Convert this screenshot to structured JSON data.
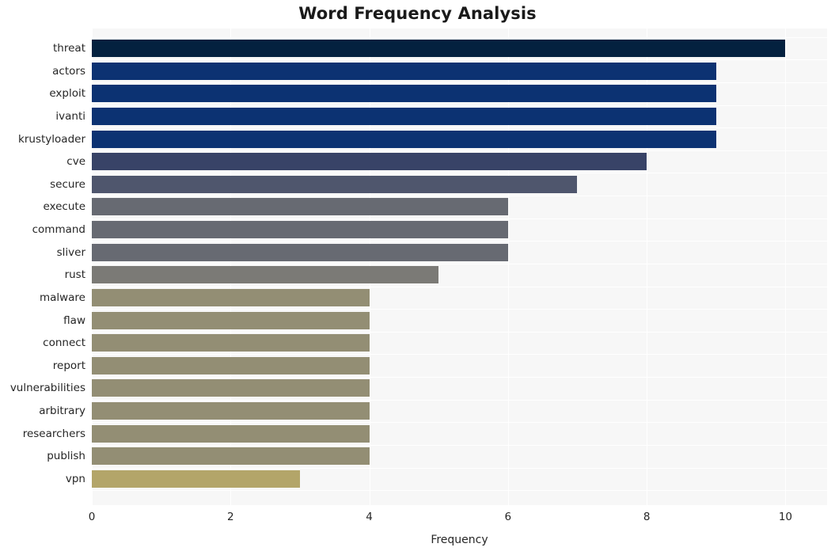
{
  "chart_data": {
    "type": "bar",
    "orientation": "horizontal",
    "title": "Word Frequency Analysis",
    "xlabel": "Frequency",
    "ylabel": "",
    "xlim": [
      0,
      10.6
    ],
    "xticks": [
      "0",
      "2",
      "4",
      "6",
      "8",
      "10"
    ],
    "xtick_values": [
      0,
      2,
      4,
      6,
      8,
      10
    ],
    "grid": true,
    "grid_color": "#ffffff",
    "plot_background": "#f7f7f7",
    "figure_background": "#ffffff",
    "legend": null,
    "categories": [
      "threat",
      "actors",
      "exploit",
      "ivanti",
      "krustyloader",
      "cve",
      "secure",
      "execute",
      "command",
      "sliver",
      "rust",
      "malware",
      "flaw",
      "connect",
      "report",
      "vulnerabilities",
      "arbitrary",
      "researchers",
      "publish",
      "vpn"
    ],
    "values": [
      10,
      9,
      9,
      9,
      9,
      8,
      7,
      6,
      6,
      6,
      5,
      4,
      4,
      4,
      4,
      4,
      4,
      4,
      4,
      3
    ],
    "colors": [
      "#04213f",
      "#0c3272",
      "#0c3272",
      "#0c3272",
      "#0c3272",
      "#384367",
      "#4f566d",
      "#676a72",
      "#676a72",
      "#676a72",
      "#7b7a76",
      "#938e74",
      "#938e74",
      "#938e74",
      "#938e74",
      "#938e74",
      "#938e74",
      "#938e74",
      "#938e74",
      "#b3a569"
    ]
  }
}
